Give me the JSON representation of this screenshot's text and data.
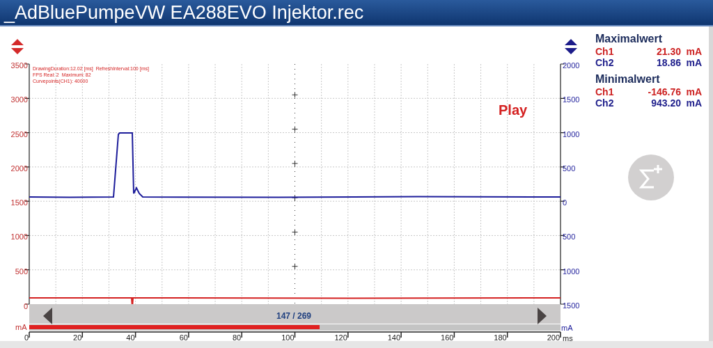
{
  "title": "_AdBluePumpeVW EA288EVO Injektor.rec",
  "chart": {
    "info_lines": [
      "DrawingDuration:12.02 [ms]  RefreshInterval:100 [ms]",
      "FPS Real: 2  Maximum: 82",
      "Curvepoints(CH1): 40000"
    ],
    "status": "Play",
    "left_axis": {
      "ticks": [
        "3500",
        "3000",
        "2500",
        "2000",
        "1500",
        "1000",
        "500",
        "0"
      ],
      "unit": "mA"
    },
    "right_axis": {
      "ticks": [
        "2000",
        "1500",
        "1000",
        "500",
        "0",
        "500",
        "1000",
        "1500"
      ],
      "unit": "mA"
    },
    "x_axis": {
      "ticks": [
        "0",
        "20",
        "40",
        "60",
        "80",
        "100",
        "120",
        "140",
        "160",
        "180",
        "200"
      ],
      "unit": "ms"
    },
    "scroll": {
      "position": "147 / 269"
    }
  },
  "stats": [
    {
      "heading": "Maximalwert",
      "rows": [
        {
          "channel": "Ch1",
          "value": "21.30",
          "unit": "mA",
          "color": "#cc1f1f"
        },
        {
          "channel": "Ch2",
          "value": "18.86",
          "unit": "mA",
          "color": "#1c1c8a"
        }
      ]
    },
    {
      "heading": "Minimalwert",
      "rows": [
        {
          "channel": "Ch1",
          "value": "-146.76",
          "unit": "mA",
          "color": "#cc1f1f"
        },
        {
          "channel": "Ch2",
          "value": "943.20",
          "unit": "mA",
          "color": "#1c1c8a"
        }
      ]
    }
  ]
}
